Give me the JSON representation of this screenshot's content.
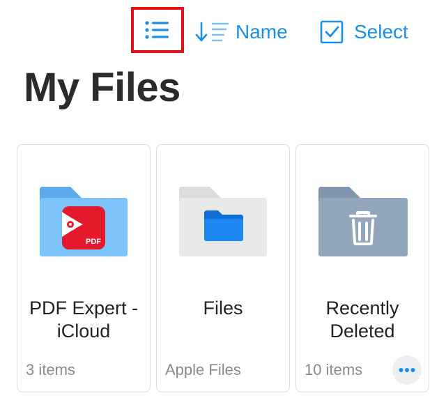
{
  "toolbar": {
    "view_toggle_icon": "list-icon",
    "sort_icon": "sort-descending-icon",
    "sort_label": "Name",
    "select_icon": "checkbox-icon",
    "select_label": "Select",
    "accent_color": "#1a8fe5",
    "highlight_color": "#e3131b"
  },
  "page": {
    "title": "My Files"
  },
  "folders": [
    {
      "name_line1": "PDF Expert -",
      "name_line2": "iCloud",
      "subtitle": "3 items",
      "icon": "pdf-expert-folder-icon",
      "folder_color": "#7cc3fa",
      "badge_color": "#e4192b"
    },
    {
      "name_line1": "Files",
      "name_line2": "",
      "subtitle": "Apple Files",
      "icon": "files-app-folder-icon",
      "folder_color": "#e9e9eb",
      "badge_color": "#1e87f0"
    },
    {
      "name_line1": "Recently",
      "name_line2": "Deleted",
      "subtitle": "10 items",
      "icon": "trash-folder-icon",
      "folder_color": "#93a7bc",
      "more_icon": "more-dots-icon"
    }
  ]
}
